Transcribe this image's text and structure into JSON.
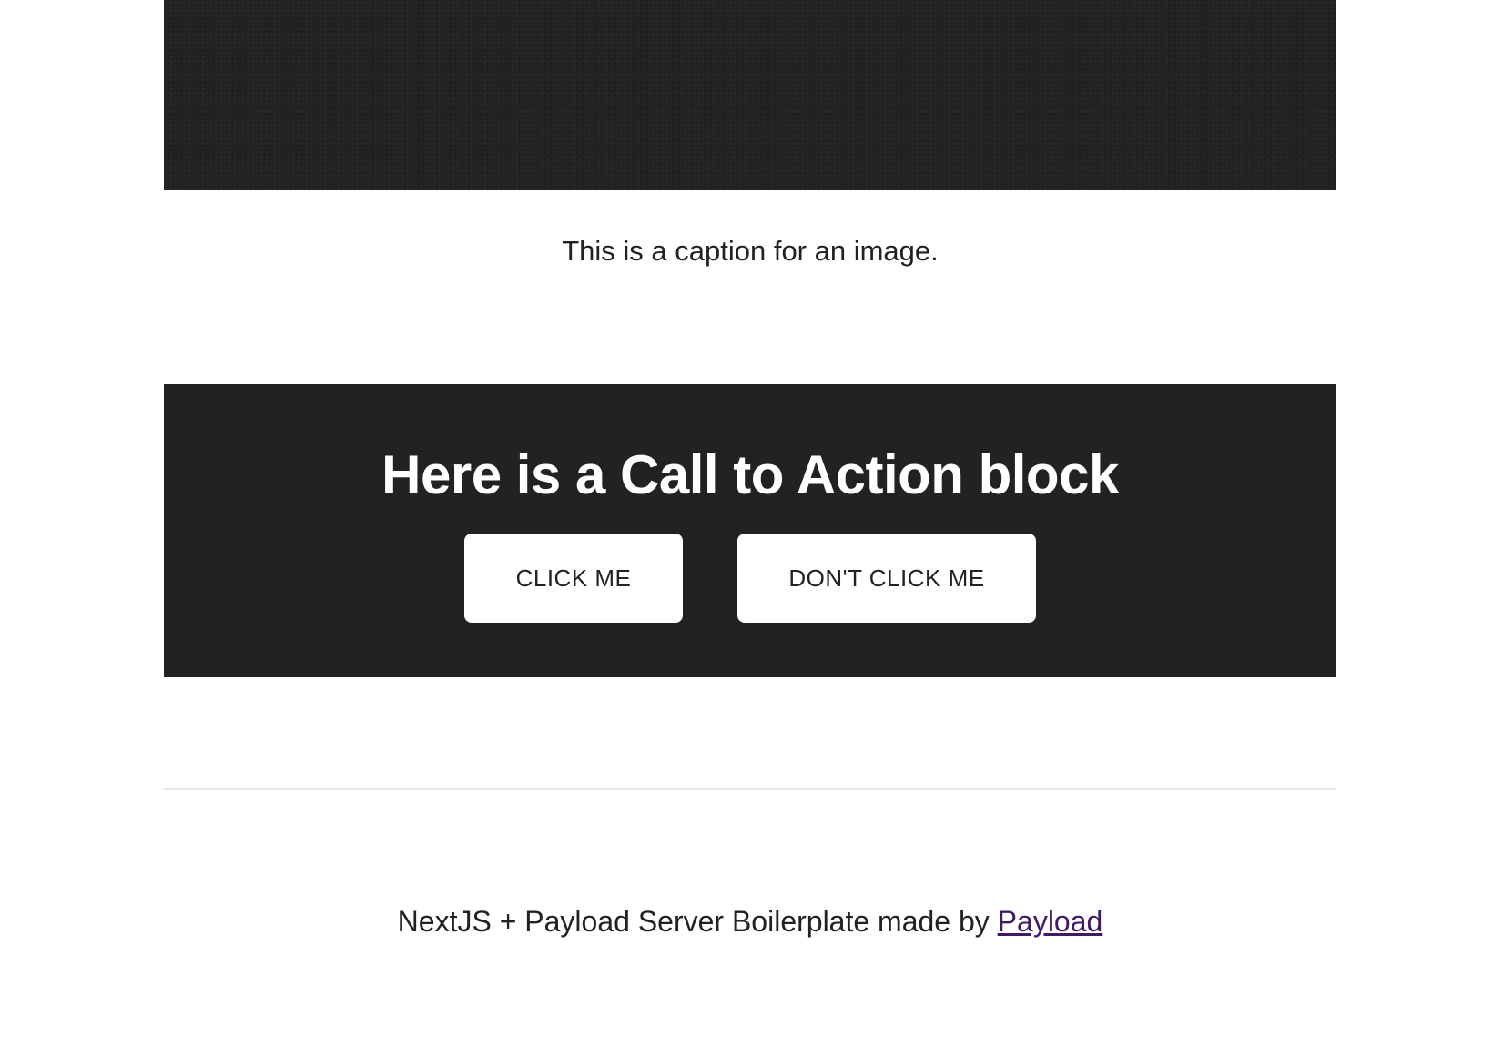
{
  "image": {
    "caption": "This is a caption for an image."
  },
  "cta": {
    "heading": "Here is a Call to Action block",
    "buttons": [
      {
        "label": "CLICK ME"
      },
      {
        "label": "DON'T CLICK ME"
      }
    ]
  },
  "footer": {
    "text": "NextJS + Payload Server Boilerplate made by ",
    "link_label": "Payload",
    "link_color": "#3f1a6b"
  },
  "colors": {
    "dark_block": "#222222",
    "background": "#ffffff",
    "divider": "#e6e6e6"
  }
}
